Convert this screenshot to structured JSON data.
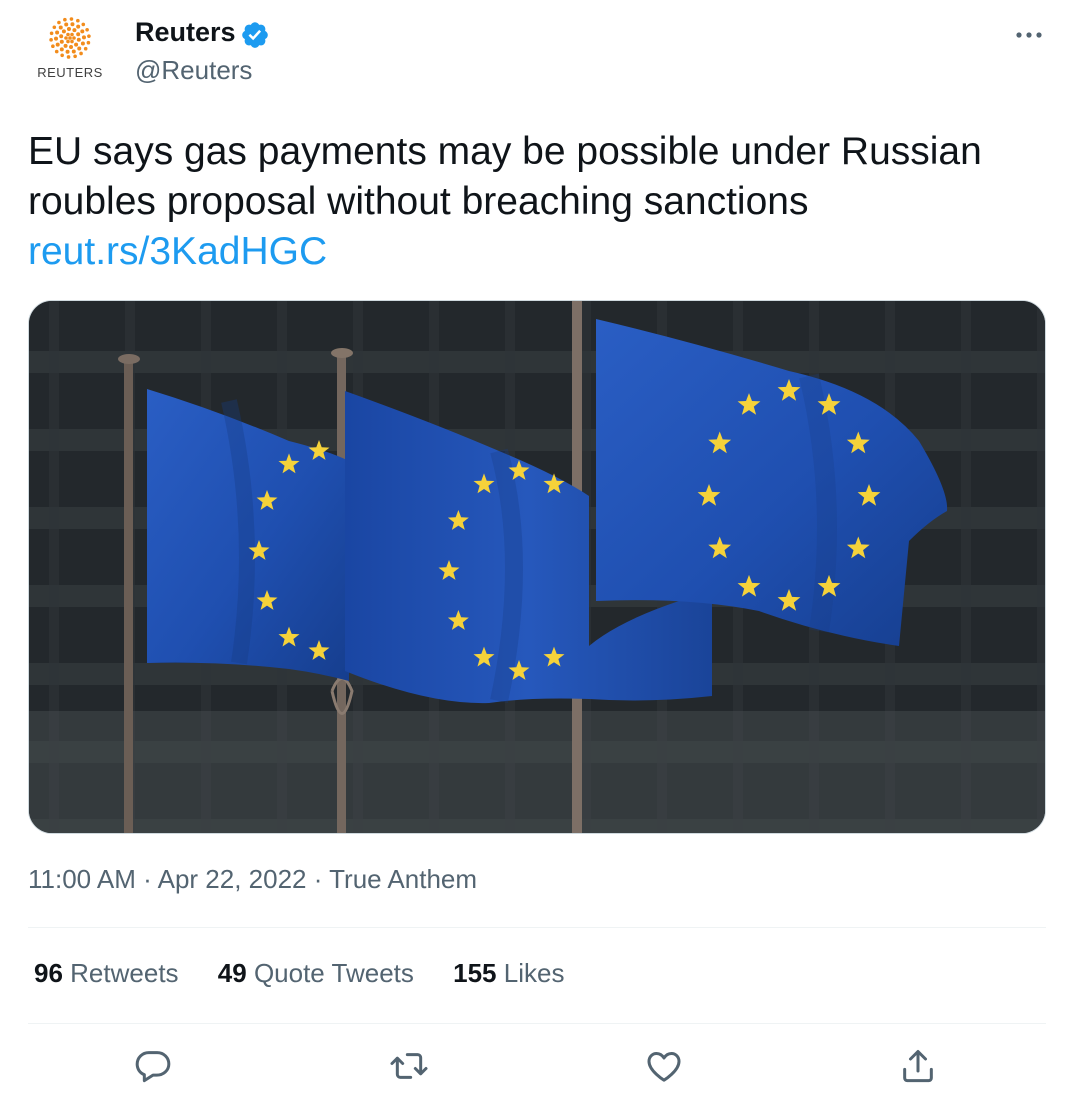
{
  "author": {
    "avatar_text": "REUTERS",
    "name": "Reuters",
    "handle": "@Reuters",
    "verified": true
  },
  "tweet": {
    "text": "EU says gas payments may be possible under Russian roubles proposal without breaching sanctions",
    "link": "reut.rs/3KadHGC"
  },
  "media": {
    "icon": "photo-eu-flags"
  },
  "meta": {
    "time": "11:00 AM",
    "separator1": " · ",
    "date": "Apr 22, 2022",
    "separator2": " · ",
    "source": "True Anthem"
  },
  "stats": {
    "retweets_count": "96",
    "retweets_label": "Retweets",
    "quotes_count": "49",
    "quotes_label": "Quote Tweets",
    "likes_count": "155",
    "likes_label": "Likes"
  },
  "actions": {
    "reply_icon": "reply-icon",
    "retweet_icon": "retweet-icon",
    "like_icon": "like-icon",
    "share_icon": "share-icon"
  },
  "colors": {
    "link": "#1d9bf0",
    "verified": "#1d9bf0",
    "muted": "#536471",
    "text": "#0f1419",
    "reuters_orange": "#f28c1c",
    "eu_blue": "#1f4fb0",
    "eu_star": "#f5d23a"
  }
}
